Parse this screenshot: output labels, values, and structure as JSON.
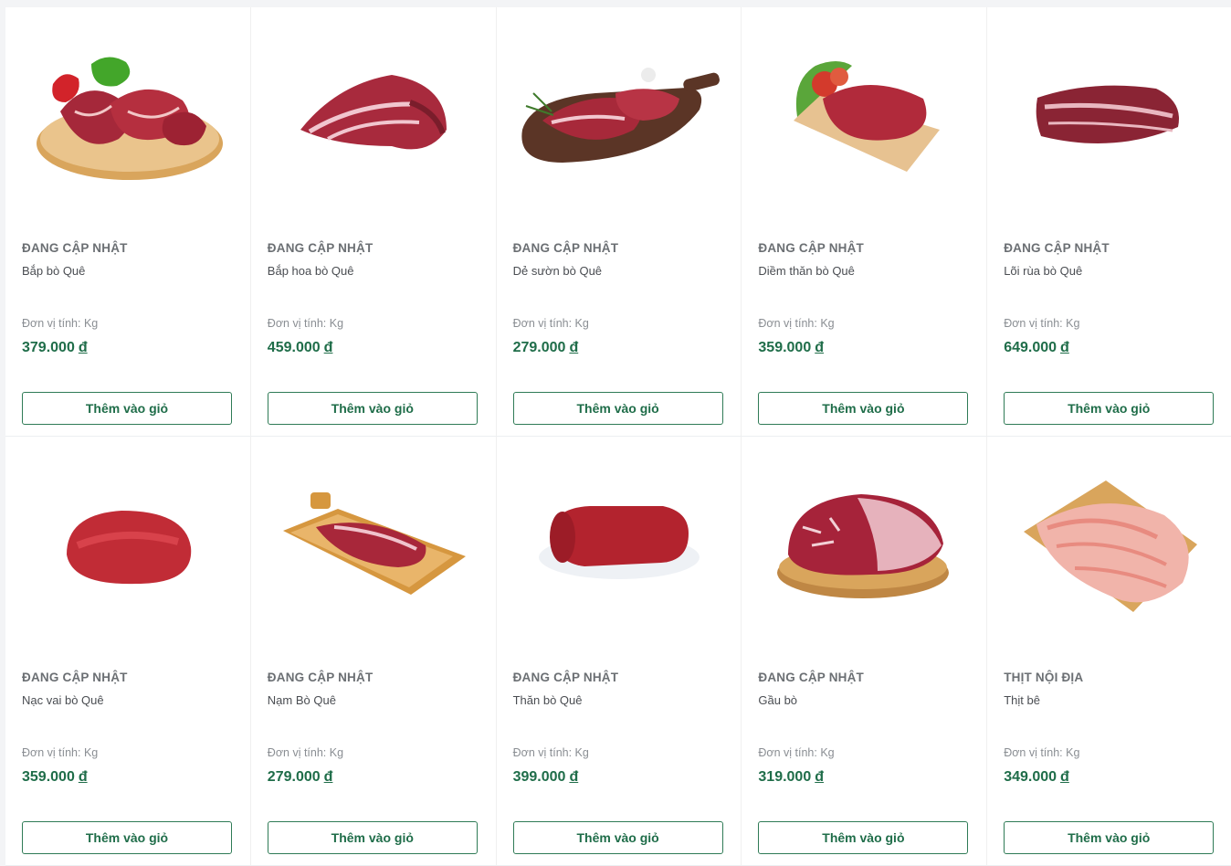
{
  "products": [
    {
      "vendor": "ĐANG CẬP NHẬT",
      "name": "Bắp bò Quê",
      "unit": "Đơn vị tính: Kg",
      "price": "379.000",
      "currency": "đ",
      "button": "Thêm vào giỏ",
      "image": "beef-shank-plate"
    },
    {
      "vendor": "ĐANG CẬP NHẬT",
      "name": "Bắp hoa bò Quê",
      "unit": "Đơn vị tính: Kg",
      "price": "459.000",
      "currency": "đ",
      "button": "Thêm vào giỏ",
      "image": "beef-flower-shank"
    },
    {
      "vendor": "ĐANG CẬP NHẬT",
      "name": "Dẻ sườn bò Quê",
      "unit": "Đơn vị tính: Kg",
      "price": "279.000",
      "currency": "đ",
      "button": "Thêm vào giỏ",
      "image": "beef-ribs-board"
    },
    {
      "vendor": "ĐANG CẬP NHẬT",
      "name": "Diềm thăn bò Quê",
      "unit": "Đơn vị tính: Kg",
      "price": "359.000",
      "currency": "đ",
      "button": "Thêm vào giỏ",
      "image": "beef-tenderloin-skirt"
    },
    {
      "vendor": "ĐANG CẬP NHẬT",
      "name": "Lõi rùa bò Quê",
      "unit": "Đơn vị tính: Kg",
      "price": "649.000",
      "currency": "đ",
      "button": "Thêm vào giỏ",
      "image": "beef-chuck-core"
    },
    {
      "vendor": "ĐANG CẬP NHẬT",
      "name": "Nạc vai bò Quê",
      "unit": "Đơn vị tính: Kg",
      "price": "359.000",
      "currency": "đ",
      "button": "Thêm vào giỏ",
      "image": "beef-shoulder"
    },
    {
      "vendor": "ĐANG CẬP NHẬT",
      "name": "Nạm Bò Quê",
      "unit": "Đơn vị tính: Kg",
      "price": "279.000",
      "currency": "đ",
      "button": "Thêm vào giỏ",
      "image": "beef-flank-tray"
    },
    {
      "vendor": "ĐANG CẬP NHẬT",
      "name": "Thăn bò Quê",
      "unit": "Đơn vị tính: Kg",
      "price": "399.000",
      "currency": "đ",
      "button": "Thêm vào giỏ",
      "image": "beef-loin-plate"
    },
    {
      "vendor": "ĐANG CẬP NHẬT",
      "name": "Gầu bò",
      "unit": "Đơn vị tính: Kg",
      "price": "319.000",
      "currency": "đ",
      "button": "Thêm vào giỏ",
      "image": "beef-brisket-board"
    },
    {
      "vendor": "THỊT NỘI ĐỊA",
      "name": "Thịt bê",
      "unit": "Đơn vị tính: Kg",
      "price": "349.000",
      "currency": "đ",
      "button": "Thêm vào giỏ",
      "image": "veal-board"
    }
  ],
  "colors": {
    "accent": "#1f6d49",
    "border": "#2f7b56",
    "meat": "#b0283a",
    "board": "#d9a55c"
  }
}
